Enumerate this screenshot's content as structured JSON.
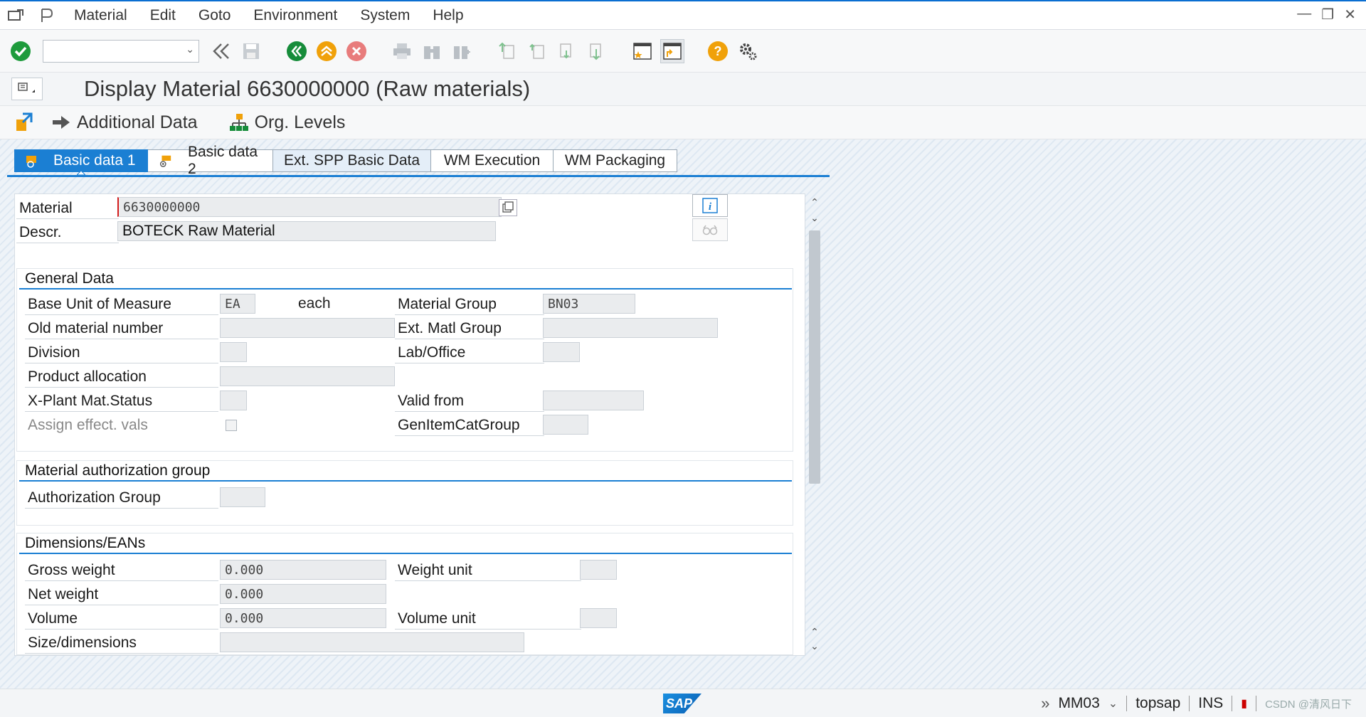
{
  "menubar": {
    "items": [
      "Material",
      "Edit",
      "Goto",
      "Environment",
      "System",
      "Help"
    ]
  },
  "toolbar": {
    "command_field_value": ""
  },
  "title": "Display Material 6630000000 (Raw materials)",
  "apptoolbar": {
    "additional_data": "Additional Data",
    "org_levels": "Org. Levels"
  },
  "tabs": [
    {
      "label": "Basic data 1",
      "active": true
    },
    {
      "label": "Basic data 2",
      "active": false
    },
    {
      "label": "Ext. SPP Basic Data",
      "active": false
    },
    {
      "label": "WM Execution",
      "active": false
    },
    {
      "label": "WM Packaging",
      "active": false
    }
  ],
  "header": {
    "material_label": "Material",
    "material_value": "6630000000",
    "descr_label": "Descr.",
    "descr_value": "BOTECK Raw Material"
  },
  "general": {
    "title": "General Data",
    "base_uom_label": "Base Unit of Measure",
    "base_uom_value": "EA",
    "base_uom_text": "each",
    "material_group_label": "Material Group",
    "material_group_value": "BN03",
    "old_material_label": "Old material number",
    "ext_matl_group_label": "Ext. Matl Group",
    "division_label": "Division",
    "lab_office_label": "Lab/Office",
    "product_allocation_label": "Product allocation",
    "xplant_status_label": "X-Plant Mat.Status",
    "valid_from_label": "Valid from",
    "assign_effect_label": "Assign effect. vals",
    "gen_item_cat_label": "GenItemCatGroup"
  },
  "auth": {
    "title": "Material authorization group",
    "auth_group_label": "Authorization Group"
  },
  "dims": {
    "title": "Dimensions/EANs",
    "gross_weight_label": "Gross weight",
    "gross_weight_value": "0.000",
    "weight_unit_label": "Weight unit",
    "net_weight_label": "Net weight",
    "net_weight_value": "0.000",
    "volume_label": "Volume",
    "volume_value": "0.000",
    "volume_unit_label": "Volume unit",
    "size_label": "Size/dimensions"
  },
  "status": {
    "transaction": "MM03",
    "server": "topsap",
    "mode": "INS",
    "watermark": "CSDN @清风日下"
  },
  "colors": {
    "accent": "#1b7fd3",
    "ok_green": "#1e9b3c",
    "nav_green": "#168c3a",
    "nav_orange": "#f0a10a",
    "cancel_red": "#e87c7c"
  }
}
